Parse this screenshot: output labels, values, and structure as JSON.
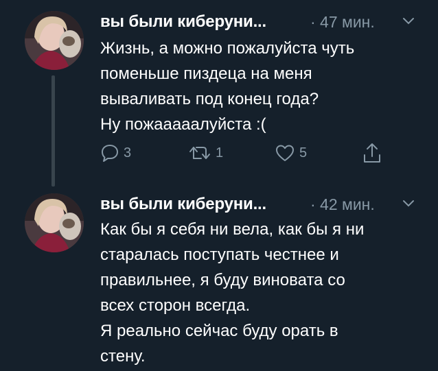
{
  "tweets": [
    {
      "author_name": "вы были киберуни...",
      "timestamp": "· 47 мин.",
      "lines": [
        "Жизнь, а можно пожалуйста чуть",
        "поменьше пиздеца на меня",
        "вываливать под конец года?",
        "Ну пожааааалуйста :("
      ],
      "actions": {
        "reply_count": "3",
        "retweet_count": "1",
        "like_count": "5"
      }
    },
    {
      "author_name": "вы были киберуни...",
      "timestamp": "· 42 мин.",
      "lines": [
        "Как бы я себя ни вела, как бы я ни",
        "старалась поступать честнее и",
        "правильнее, я буду виновата со",
        "всех сторон всегда.",
        "Я реально сейчас буду орать в",
        "стену."
      ]
    }
  ],
  "icons": {
    "reply": "reply-icon",
    "retweet": "retweet-icon",
    "like": "heart-icon",
    "share": "share-icon",
    "menu": "chevron-down-icon"
  },
  "colors": {
    "background": "#15202b",
    "text": "#ffffff",
    "secondary_text": "#8899a6",
    "thread_line": "#38444d"
  }
}
